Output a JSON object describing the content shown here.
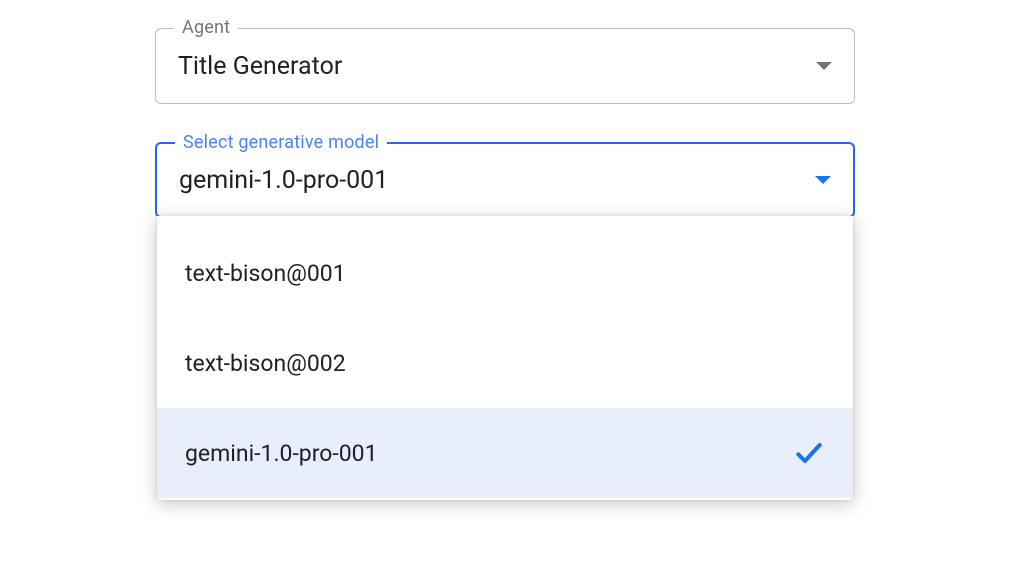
{
  "agent_field": {
    "label": "Agent",
    "value": "Title Generator"
  },
  "model_field": {
    "label": "Select generative model",
    "value": "gemini-1.0-pro-001",
    "options": [
      {
        "label": "text-bison@001",
        "selected": false
      },
      {
        "label": "text-bison@002",
        "selected": false
      },
      {
        "label": "gemini-1.0-pro-001",
        "selected": true
      }
    ]
  }
}
